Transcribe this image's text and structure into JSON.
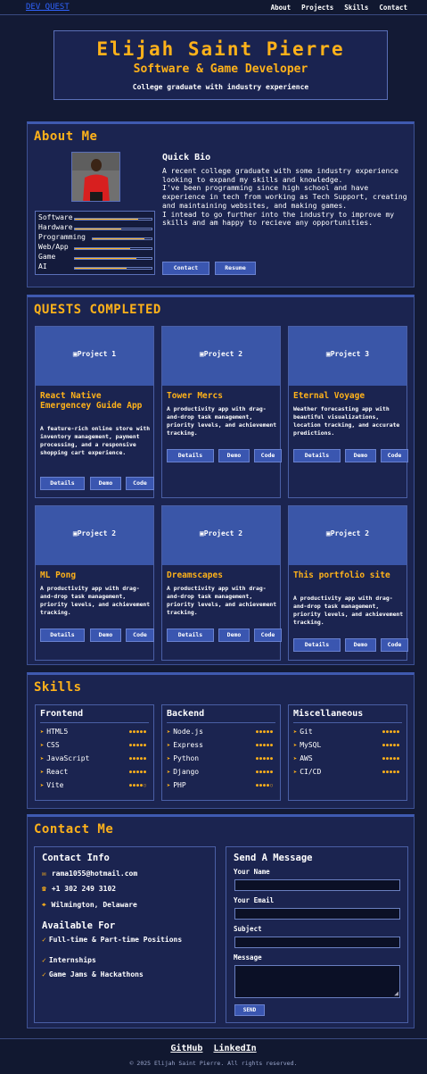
{
  "nav": {
    "logo": "DEV QUEST",
    "links": [
      "About",
      "Projects",
      "Skills",
      "Contact"
    ]
  },
  "hero": {
    "name": "Elijah Saint Pierre",
    "role": "Software & Game Developer",
    "subtitle": "College graduate with industry experience"
  },
  "about": {
    "title": "About Me",
    "bio_title": "Quick Bio",
    "bio": "A recent college graduate with some industry experience looking to expand my skills and knowledge.\nI've been programming since high school and have experience in tech from working as Tech Support, creating and maintaining websites, and making games.\nI intead to go further into the industry to improve my skills and am happy to recieve any opportunities.",
    "skills": [
      {
        "label": "Software",
        "level": 0.82
      },
      {
        "label": "Hardware",
        "level": 0.6
      },
      {
        "label": "Programming",
        "level": 0.88
      },
      {
        "label": "Web/App",
        "level": 0.72
      },
      {
        "label": "Game",
        "level": 0.8
      },
      {
        "label": "AI",
        "level": 0.68
      }
    ],
    "buttons": {
      "contact": "Contact",
      "resume": "Resume"
    }
  },
  "quests": {
    "title": "QUESTS COMPLETED",
    "buttons": {
      "details": "Details",
      "demo": "Demo",
      "code": "Code"
    },
    "projects": [
      {
        "image": "Project 1",
        "title": "React Native Emergencey Guide App",
        "desc": "A feature-rich online store with inventory management, payment processing, and a responsive shopping cart experience."
      },
      {
        "image": "Project 2",
        "title": "Tower Mercs",
        "desc": "A productivity app with drag-and-drop task management, priority levels, and achievement tracking."
      },
      {
        "image": "Project 3",
        "title": "Eternal Voyage",
        "desc": "Weather forecasting app with beautiful visualizations, location tracking, and accurate predictions."
      },
      {
        "image": "Project 2",
        "title": "ML Pong",
        "desc": "A productivity app with drag-and-drop task management, priority levels, and achievement tracking."
      },
      {
        "image": "Project 2",
        "title": "Dreamscapes",
        "desc": "A productivity app with drag-and-drop task management, priority levels, and achievement tracking."
      },
      {
        "image": "Project 2",
        "title": "This portfolio site",
        "desc": "A productivity app with drag-and-drop task management, priority levels, and achievement tracking."
      }
    ]
  },
  "skills": {
    "title": "Skills",
    "columns": [
      {
        "title": "Frontend",
        "items": [
          {
            "name": "HTML5",
            "rating": 5
          },
          {
            "name": "CSS",
            "rating": 5
          },
          {
            "name": "JavaScript",
            "rating": 5
          },
          {
            "name": "React",
            "rating": 5
          },
          {
            "name": "Vite",
            "rating": 4
          }
        ]
      },
      {
        "title": "Backend",
        "items": [
          {
            "name": "Node.js",
            "rating": 5
          },
          {
            "name": "Express",
            "rating": 5
          },
          {
            "name": "Python",
            "rating": 5
          },
          {
            "name": "Django",
            "rating": 5
          },
          {
            "name": "PHP",
            "rating": 4
          }
        ]
      },
      {
        "title": "Miscellaneous",
        "items": [
          {
            "name": "Git",
            "rating": 5
          },
          {
            "name": "MySQL",
            "rating": 5
          },
          {
            "name": "AWS",
            "rating": 5
          },
          {
            "name": "CI/CD",
            "rating": 5
          }
        ]
      }
    ]
  },
  "contact": {
    "title": "Contact Me",
    "info_title": "Contact Info",
    "email": "rama1055@hotmail.com",
    "phone": "+1 302 249 3102",
    "location": "Wilmington, Delaware",
    "available_title": "Available For",
    "available": [
      "Full-time & Part-time Positions",
      "Internships",
      "Game Jams & Hackathons"
    ],
    "form_title": "Send A Message",
    "labels": {
      "name": "Your Name",
      "email": "Your Email",
      "subject": "Subject",
      "message": "Message"
    },
    "send": "SEND"
  },
  "footer": {
    "github": "GitHub",
    "linkedin": "LinkedIn",
    "copyright": "© 2025 Elijah Saint Pierre. All rights reserved."
  },
  "colors": {
    "accent": "#ffb21a",
    "background": "#131a35",
    "panel": "#1b2450",
    "button": "#3a56b0"
  }
}
